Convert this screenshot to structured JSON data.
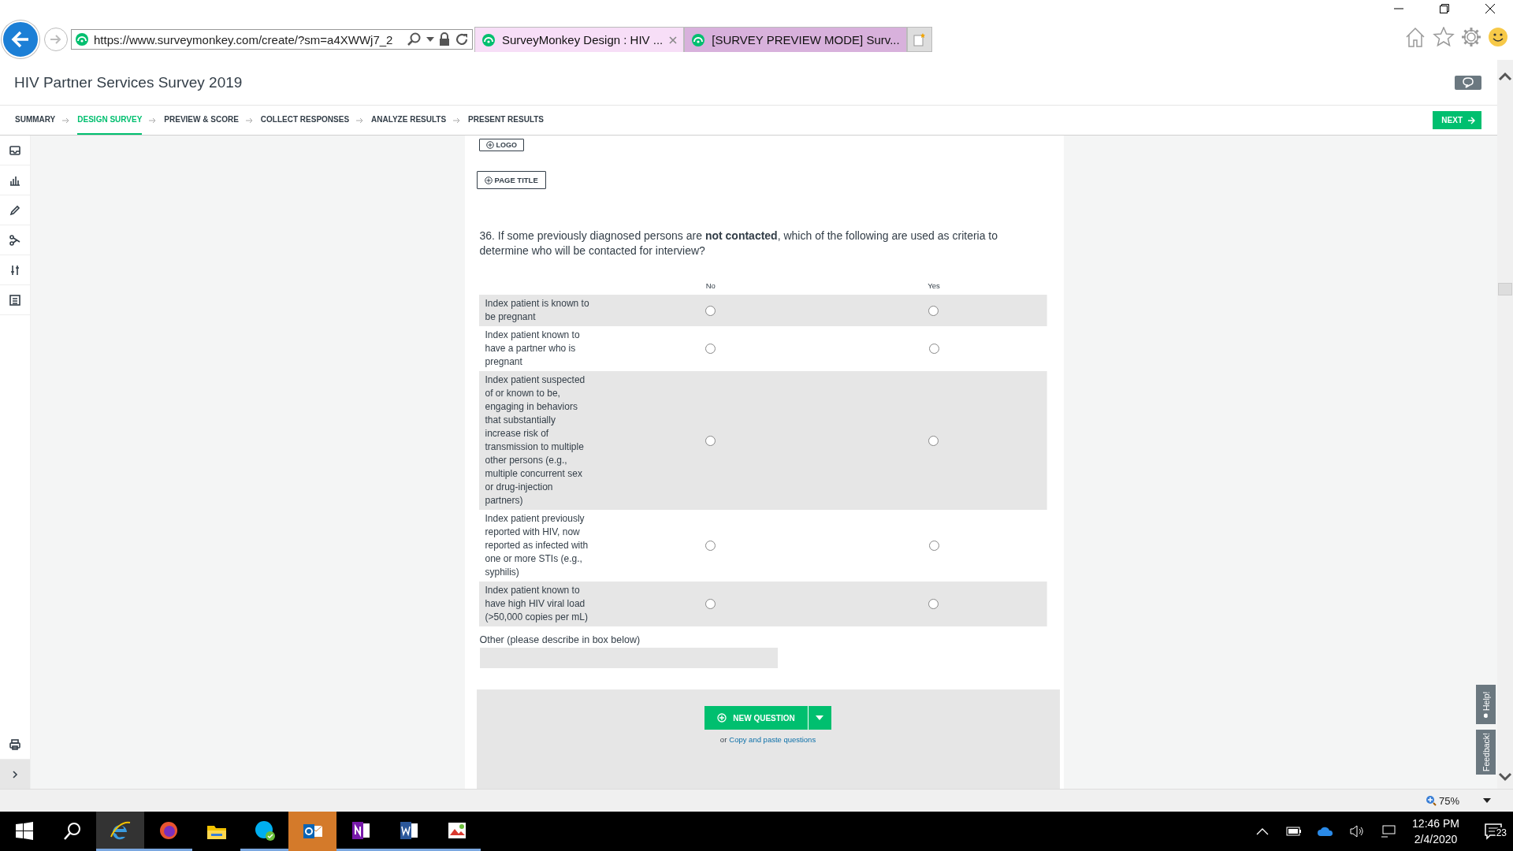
{
  "browser": {
    "url": "https://www.surveymonkey.com/create/?sm=a4XWWj7_2",
    "tabs": [
      {
        "title": "SurveyMonkey Design : HIV ...",
        "selected": true
      },
      {
        "title": "[SURVEY PREVIEW MODE] Surv...",
        "selected": false
      }
    ],
    "zoom": "75%"
  },
  "survey": {
    "title": "HIV Partner Services Survey 2019",
    "nav": [
      {
        "label": "SUMMARY",
        "selected": false
      },
      {
        "label": "DESIGN SURVEY",
        "selected": true
      },
      {
        "label": "PREVIEW & SCORE",
        "selected": false
      },
      {
        "label": "COLLECT RESPONSES",
        "selected": false
      },
      {
        "label": "ANALYZE RESULTS",
        "selected": false
      },
      {
        "label": "PRESENT RESULTS",
        "selected": false
      }
    ],
    "next_button": "NEXT"
  },
  "page": {
    "logo_button": "LOGO",
    "page_title_button": "PAGE TITLE"
  },
  "question": {
    "text": "36. If some previously diagnosed persons are  **not contacted**, which of the following are used as criteria to determine who will be contacted for interview?",
    "columns": [
      "No",
      "Yes"
    ],
    "rows": [
      {
        "label": "Index patient is known to be pregnant",
        "answers": [
          {
            "selected": false
          },
          {
            "selected": false
          }
        ]
      },
      {
        "label": "Index patient known to have a partner who is pregnant",
        "answers": [
          {
            "selected": false
          },
          {
            "selected": false
          }
        ]
      },
      {
        "label": "Index patient suspected of or known to be, engaging in behaviors that substantially increase risk of transmission to multiple other persons (e.g., multiple concurrent sex or drug-injection partners)",
        "answers": [
          {
            "selected": false
          },
          {
            "selected": false
          }
        ]
      },
      {
        "label": "Index patient previously reported with HIV, now reported as infected with one or more STIs (e.g., syphilis)",
        "answers": [
          {
            "selected": false
          },
          {
            "selected": false
          }
        ]
      },
      {
        "label": "Index patient known to have high HIV viral load (>50,000 copies per mL)",
        "answers": [
          {
            "selected": false
          },
          {
            "selected": false
          }
        ]
      }
    ],
    "other_label": "Other (please describe in box below)"
  },
  "add": {
    "new_question_button": "NEW QUESTION",
    "or_text": "or",
    "copy_link": "Copy and paste questions"
  },
  "side_tabs": [
    "Help!",
    "Feedback!"
  ],
  "taskbar": {
    "time": "12:46 PM",
    "date": "2/4/2020",
    "notifications": "23"
  }
}
